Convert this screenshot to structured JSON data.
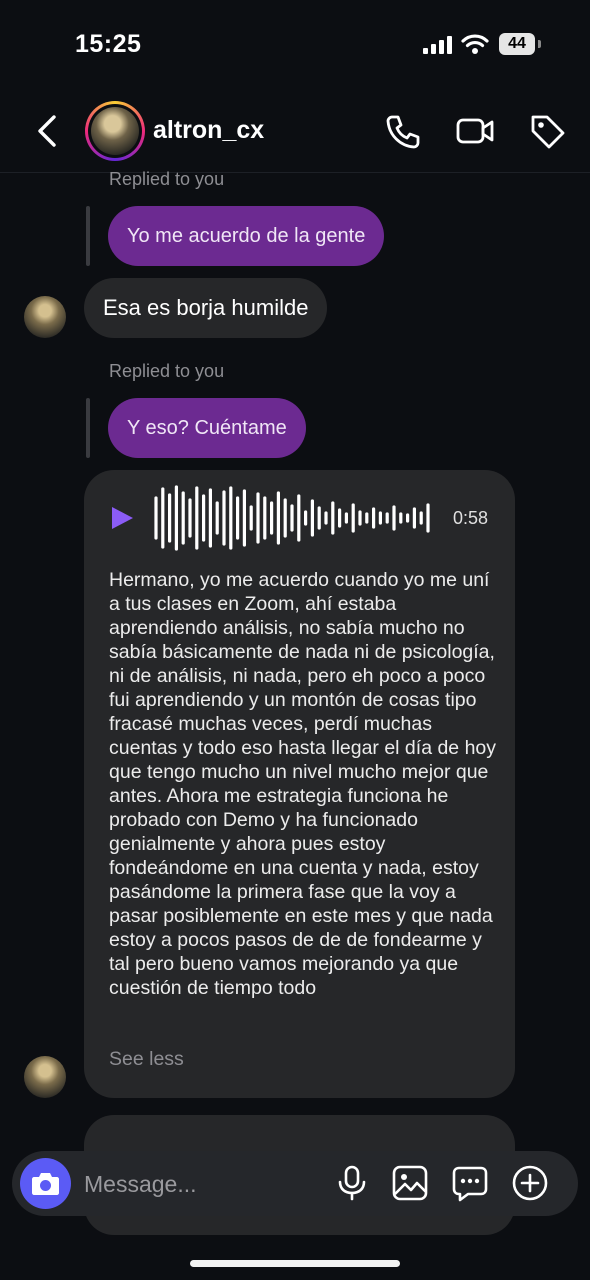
{
  "status_bar": {
    "time": "15:25",
    "battery": "44"
  },
  "header": {
    "username": "altron_cx"
  },
  "messages": {
    "replied_label_1": "Replied to you",
    "out_1": "Yo me acuerdo de la gente",
    "in_1": "Esa es borja humilde",
    "replied_label_2": "Replied to you",
    "out_2": "Y eso? Cuéntame",
    "voice": {
      "duration": "0:58",
      "transcript": "Hermano, yo me acuerdo cuando yo me uní a tus clases en Zoom, ahí estaba aprendiendo análisis, no sabía mucho no sabía básicamente de nada ni de psicología, ni de análisis, ni nada, pero eh poco a poco fui aprendiendo y un montón de cosas tipo fracasé muchas veces, perdí muchas cuentas y todo eso hasta llegar el día de hoy que tengo mucho un nivel mucho mejor que antes. Ahora me estrategia funciona he probado con Demo y ha funcionado genialmente y ahora pues estoy fondeándome en una cuenta y nada, estoy pasándome la primera fase que la voy a pasar posiblemente en este mes y que nada estoy a pocos pasos de de de fondearme y tal pero bueno vamos mejorando ya que cuestión de tiempo todo",
      "see_less": "See less"
    }
  },
  "composer": {
    "placeholder": "Message..."
  },
  "colors": {
    "outgoing_bubble": "#6c2a91",
    "incoming_bubble": "#262729",
    "accent": "#8b5cf6",
    "camera_button": "#5b5bf5"
  }
}
